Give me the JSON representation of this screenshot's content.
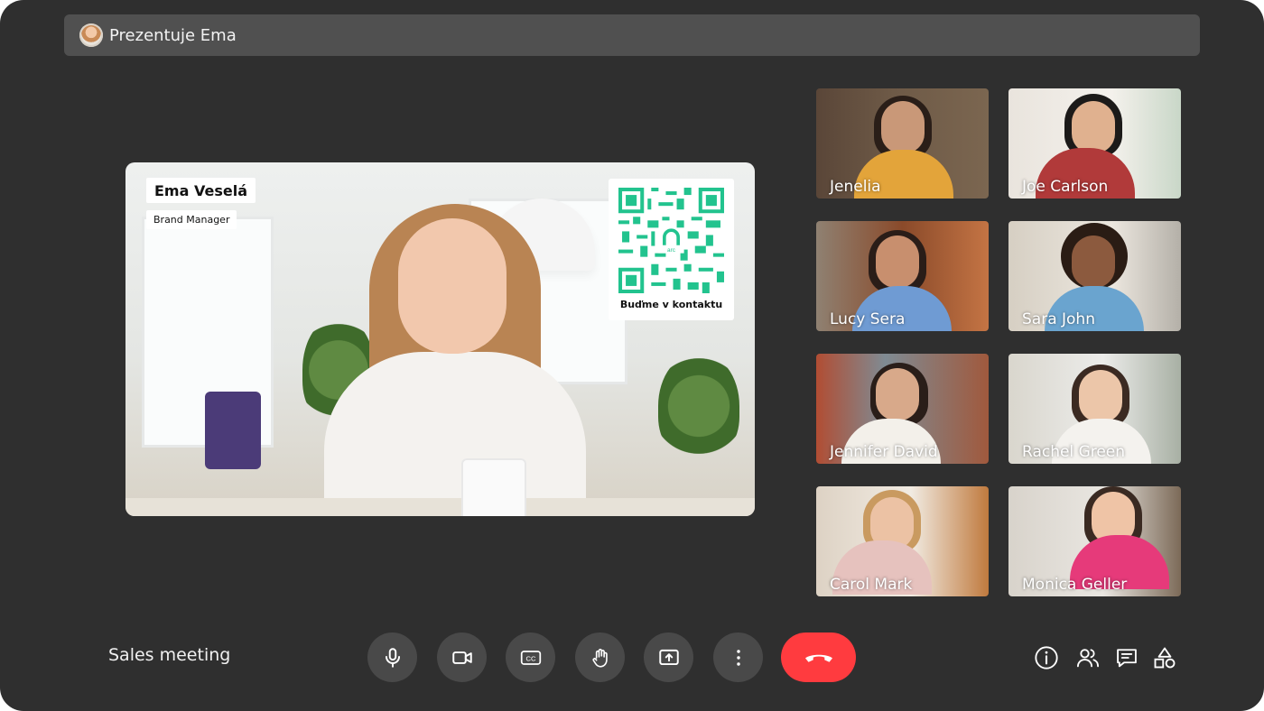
{
  "header": {
    "presenter_label": "Prezentuje Ema"
  },
  "main_speaker": {
    "name": "Ema Veselá",
    "role": "Brand Manager",
    "qr_caption": "Buďme v kontaktu",
    "qr_logo_text": "arc"
  },
  "participants": [
    {
      "name": "Jenelia"
    },
    {
      "name": "Joe Carlson"
    },
    {
      "name": "Lucy  Sera"
    },
    {
      "name": "Sara John"
    },
    {
      "name": "Jennifer David"
    },
    {
      "name": "Rachel Green"
    },
    {
      "name": "Carol Mark"
    },
    {
      "name": "Monica Geller"
    }
  ],
  "footer": {
    "meeting_title": "Sales meeting",
    "controls": [
      {
        "icon": "microphone-icon"
      },
      {
        "icon": "camera-icon"
      },
      {
        "icon": "captions-icon",
        "label": "CC"
      },
      {
        "icon": "raise-hand-icon"
      },
      {
        "icon": "present-screen-icon"
      },
      {
        "icon": "more-vertical-icon"
      }
    ],
    "end_call_icon": "end-call-icon",
    "right_icons": [
      "info-icon",
      "people-icon",
      "chat-icon",
      "activities-icon"
    ]
  },
  "colors": {
    "background": "#2f2f2f",
    "bar": "#505050",
    "control": "#494949",
    "end_call": "#ff3b3f",
    "qr": "#22c38e"
  }
}
